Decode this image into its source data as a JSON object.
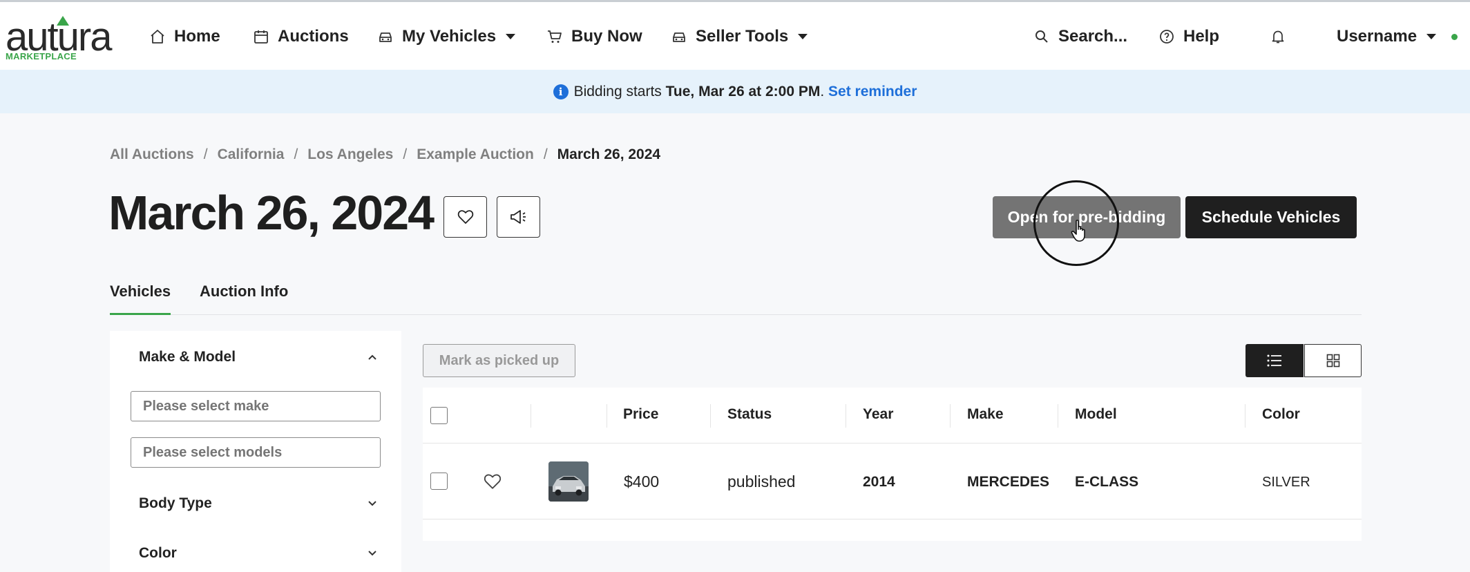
{
  "nav": {
    "logo_text": "autura",
    "logo_sub": "MARKETPLACE",
    "home": "Home",
    "auctions": "Auctions",
    "my_vehicles": "My Vehicles",
    "buy_now": "Buy Now",
    "seller_tools": "Seller Tools",
    "search": "Search...",
    "help": "Help",
    "username": "Username"
  },
  "banner": {
    "prefix": "Bidding starts",
    "datetime": "Tue, Mar 26 at 2:00 PM",
    "period": ".",
    "link": "Set reminder"
  },
  "breadcrumb": {
    "items": [
      "All Auctions",
      "California",
      "Los Angeles",
      "Example Auction"
    ],
    "current": "March 26, 2024",
    "separator": "/"
  },
  "page": {
    "title": "March 26, 2024",
    "open_prebid_button": "Open for pre-bidding",
    "schedule_button": "Schedule Vehicles"
  },
  "tabs": [
    "Vehicles",
    "Auction Info"
  ],
  "filters": {
    "make_model": "Make & Model",
    "make_placeholder": "Please select make",
    "models_placeholder": "Please select models",
    "body_type": "Body Type",
    "color": "Color"
  },
  "toolbar": {
    "mark_picked_up": "Mark as picked up"
  },
  "table": {
    "columns": [
      "Price",
      "Status",
      "Year",
      "Make",
      "Model",
      "Color"
    ],
    "rows": [
      {
        "price": "$400",
        "status": "published",
        "year": "2014",
        "make": "MERCEDES",
        "model": "E-CLASS",
        "color": "SILVER"
      }
    ]
  },
  "colors": {
    "accent_green": "#3aa54a",
    "link_blue": "#1e6fd9",
    "banner_bg": "#e6f2fb"
  }
}
